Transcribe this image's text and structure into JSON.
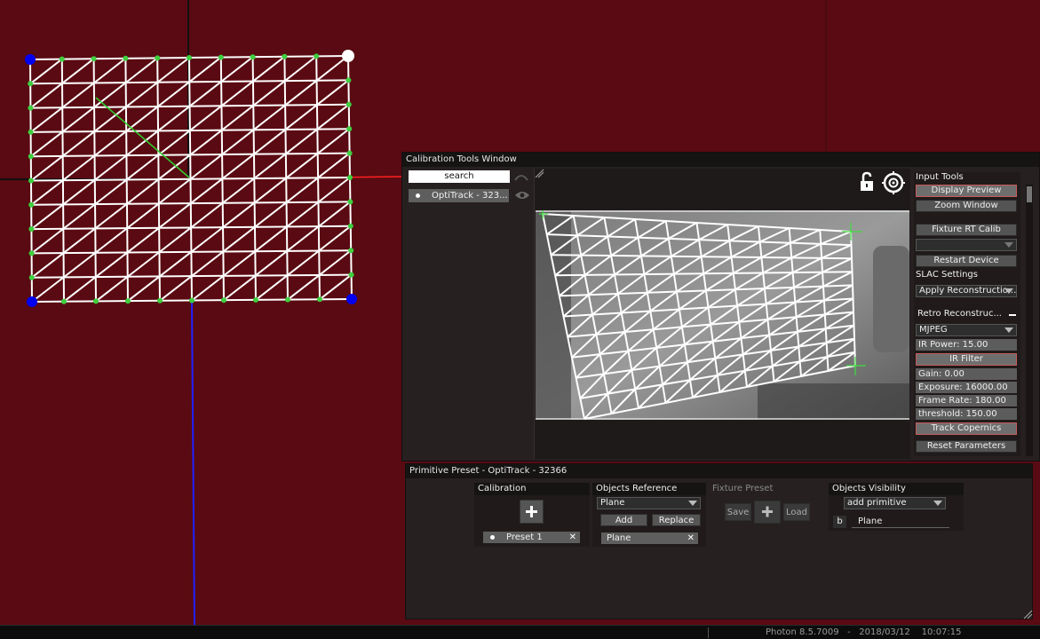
{
  "app": {
    "status_text": "Photon 8.5.7009   -   2018/03/12    10:07:15"
  },
  "colors": {
    "viewport_bg": "#5a0a12",
    "grid_line": "#ffffff",
    "grid_point": "#3fcf3f",
    "corner_point": "#0000ee",
    "active_corner": "#ffffff",
    "axis_x": "#ff2020",
    "axis_z": "#2020ff",
    "highlight_border": "#c85a5a"
  },
  "calibration_window": {
    "title": "Calibration Tools Window",
    "search": {
      "value": "search"
    },
    "devices": [
      {
        "label": "OptiTrack - 323..."
      }
    ],
    "icons": {
      "lock": "unlock-icon",
      "target": "crosshair-icon",
      "visibility": "eye-icon"
    },
    "input_tools": {
      "title": "Input Tools",
      "display_preview": "Display Preview",
      "zoom_window": "Zoom Window",
      "fixture_rt_calib": "Fixture RT Calib",
      "fixture_select": "",
      "restart_device": "Restart Device",
      "slac_settings": "SLAC Settings",
      "apply_reconstruction": "Apply Reconstructio...",
      "retro_reconstruction": "Retro Reconstruc...",
      "codec": "MJPEG",
      "ir_power": "IR Power: 15.00",
      "ir_filter": "IR Filter",
      "gain": "Gain: 0.00",
      "exposure": "Exposure: 16000.00",
      "frame_rate": "Frame Rate: 180.00",
      "threshold": "threshold: 150.00",
      "track_copernics": "Track Copernics",
      "reset_parameters": "Reset Parameters"
    }
  },
  "preset_window": {
    "title": "Primitive Preset - OptiTrack - 32366",
    "calibration": {
      "title": "Calibration",
      "preset": "Preset 1"
    },
    "objects_reference": {
      "title": "Objects Reference",
      "select": "Plane",
      "add": "Add",
      "replace": "Replace",
      "item": "Plane"
    },
    "fixture_preset": {
      "title": "Fixture Preset",
      "save": "Save",
      "load": "Load"
    },
    "objects_visibility": {
      "title": "Objects Visibility",
      "select": "add primitive",
      "badge": "b",
      "item": "Plane"
    }
  }
}
